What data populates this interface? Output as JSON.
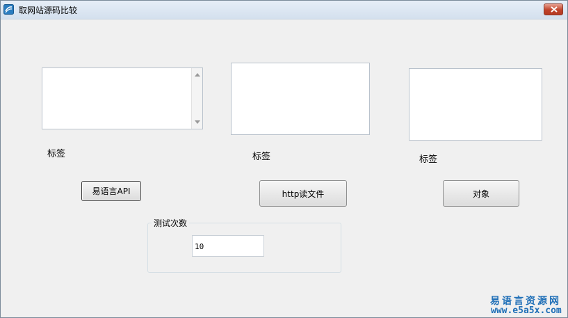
{
  "window": {
    "title": "取网站源码比较",
    "app_icon": "app-icon",
    "close_icon": "close-icon"
  },
  "main": {
    "result_label_1": "标签",
    "result_label_2": "标签",
    "result_label_3": "标签",
    "button_api": "易语言API",
    "button_http": "http读文件",
    "button_object": "对象",
    "test_group_caption": "测试次数",
    "test_count_value": "10"
  },
  "watermark": {
    "name": "易语言资源网",
    "url": "www.e5a5x.com"
  },
  "colors": {
    "background": "#f0f0f0",
    "watermark": "#1f6fb7",
    "close_button": "#c0432b"
  }
}
